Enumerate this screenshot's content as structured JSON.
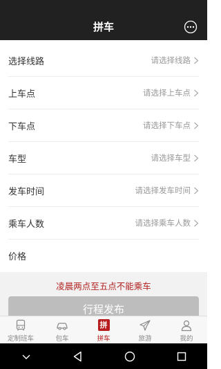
{
  "header": {
    "title": "拼车",
    "chat_icon": "chat-bubble-icon"
  },
  "form": {
    "rows": [
      {
        "label": "选择线路",
        "placeholder": "请选择线路"
      },
      {
        "label": "上车点",
        "placeholder": "请选择上车点"
      },
      {
        "label": "下车点",
        "placeholder": "请选择下车点"
      },
      {
        "label": "车型",
        "placeholder": "请选择车型"
      },
      {
        "label": "发车时间",
        "placeholder": "请选择发车时间"
      },
      {
        "label": "乘车人数",
        "placeholder": "请选择乘车人数"
      },
      {
        "label": "价格",
        "placeholder": ""
      }
    ]
  },
  "notice": {
    "warning": "凌晨两点至五点不能乘车",
    "warning_color": "#b21f1f"
  },
  "publish_button": {
    "label": "行程发布",
    "color": "#bdbdbd"
  },
  "tabbar": {
    "tabs": [
      {
        "label": "定制班车",
        "icon": "bus-icon",
        "active": false
      },
      {
        "label": "包车",
        "icon": "car-icon",
        "active": false
      },
      {
        "label": "拼车",
        "icon": "carpool-icon",
        "active": true,
        "icon_text": "拼"
      },
      {
        "label": "旅游",
        "icon": "airplane-icon",
        "active": false
      },
      {
        "label": "我的",
        "icon": "user-icon",
        "active": false
      }
    ],
    "active_color": "#b71c1c"
  },
  "system_nav": {
    "buttons": [
      "collapse-icon",
      "back-icon",
      "home-icon",
      "recents-icon"
    ]
  }
}
